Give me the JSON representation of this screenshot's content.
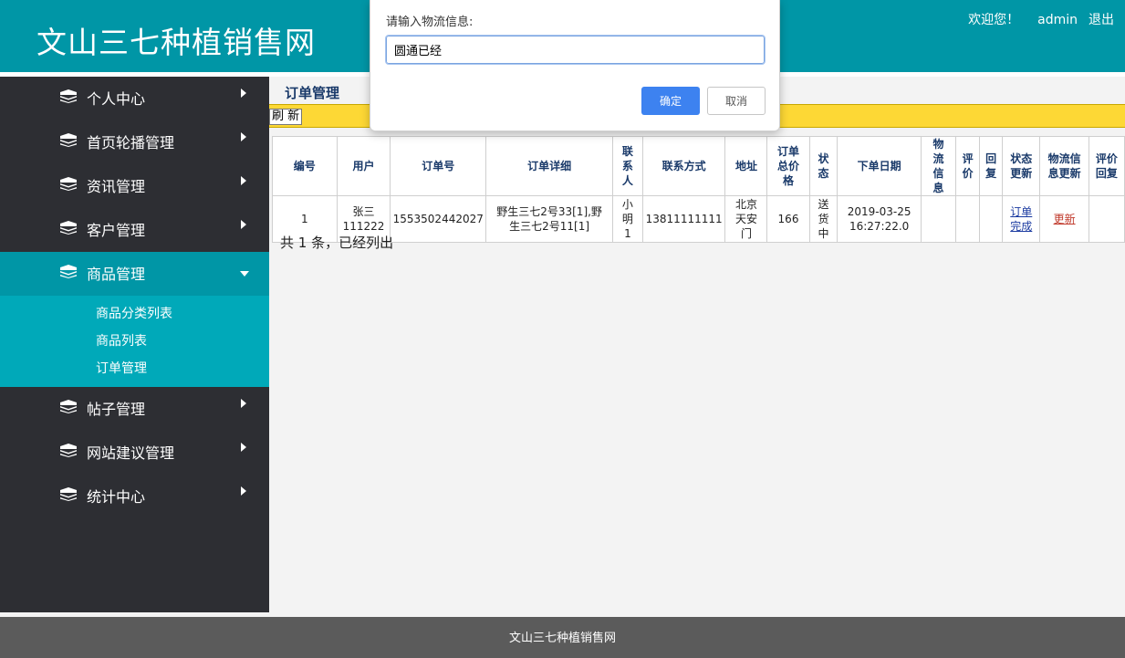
{
  "header": {
    "site_title": "文山三七种植销售网",
    "welcome": "欢迎您！",
    "username": "admin",
    "logout": "退出"
  },
  "sidebar": {
    "items": [
      {
        "label": "个人中心",
        "icon": "stack-icon"
      },
      {
        "label": "首页轮播管理",
        "icon": "stack-icon"
      },
      {
        "label": "资讯管理",
        "icon": "stack-icon"
      },
      {
        "label": "客户管理",
        "icon": "stack-icon"
      },
      {
        "label": "商品管理",
        "icon": "stack-icon",
        "active": true
      },
      {
        "label": "帖子管理",
        "icon": "stack-icon"
      },
      {
        "label": "网站建议管理",
        "icon": "stack-icon"
      },
      {
        "label": "统计中心",
        "icon": "stack-icon"
      }
    ],
    "submenu": [
      "商品分类列表",
      "商品列表",
      "订单管理"
    ]
  },
  "main": {
    "title": "订单管理",
    "refresh_label": "刷 新",
    "table": {
      "headers": [
        "编号",
        "用户",
        "订单号",
        "订单详细",
        "联系人",
        "联系方式",
        "地址",
        "订单总价格",
        "状态",
        "下单日期",
        "物流信息",
        "评价",
        "回复",
        "状态更新",
        "物流信息更新",
        "评价回复"
      ],
      "rows": [
        {
          "id": "1",
          "user": "张三111222",
          "order_no": "1553502442027",
          "detail": "野生三七2号33[1],野生三七2号11[1]",
          "contact": "小明1",
          "phone": "13811111111",
          "address": "北京天安门",
          "total": "166",
          "status": "送货中",
          "date": "2019-03-25 16:27:22.0",
          "logistics": "",
          "review": "",
          "reply": "",
          "status_update": "订单完成",
          "logistics_update": "更新",
          "review_reply": ""
        }
      ]
    },
    "summary": "共 1 条，已经列出"
  },
  "footer": {
    "text": "文山三七种植销售网"
  },
  "dialog": {
    "prompt": "请输入物流信息:",
    "input_value": "圆通已经",
    "ok_label": "确定",
    "cancel_label": "取消"
  },
  "colors": {
    "header_bg": "#0096a6",
    "sidebar_bg": "#2d2e33",
    "submenu_bg": "#00a9b9",
    "toolbar_bg": "#fdd835",
    "ok_button": "#3d82f0",
    "footer_bg": "#5b5b5b"
  }
}
